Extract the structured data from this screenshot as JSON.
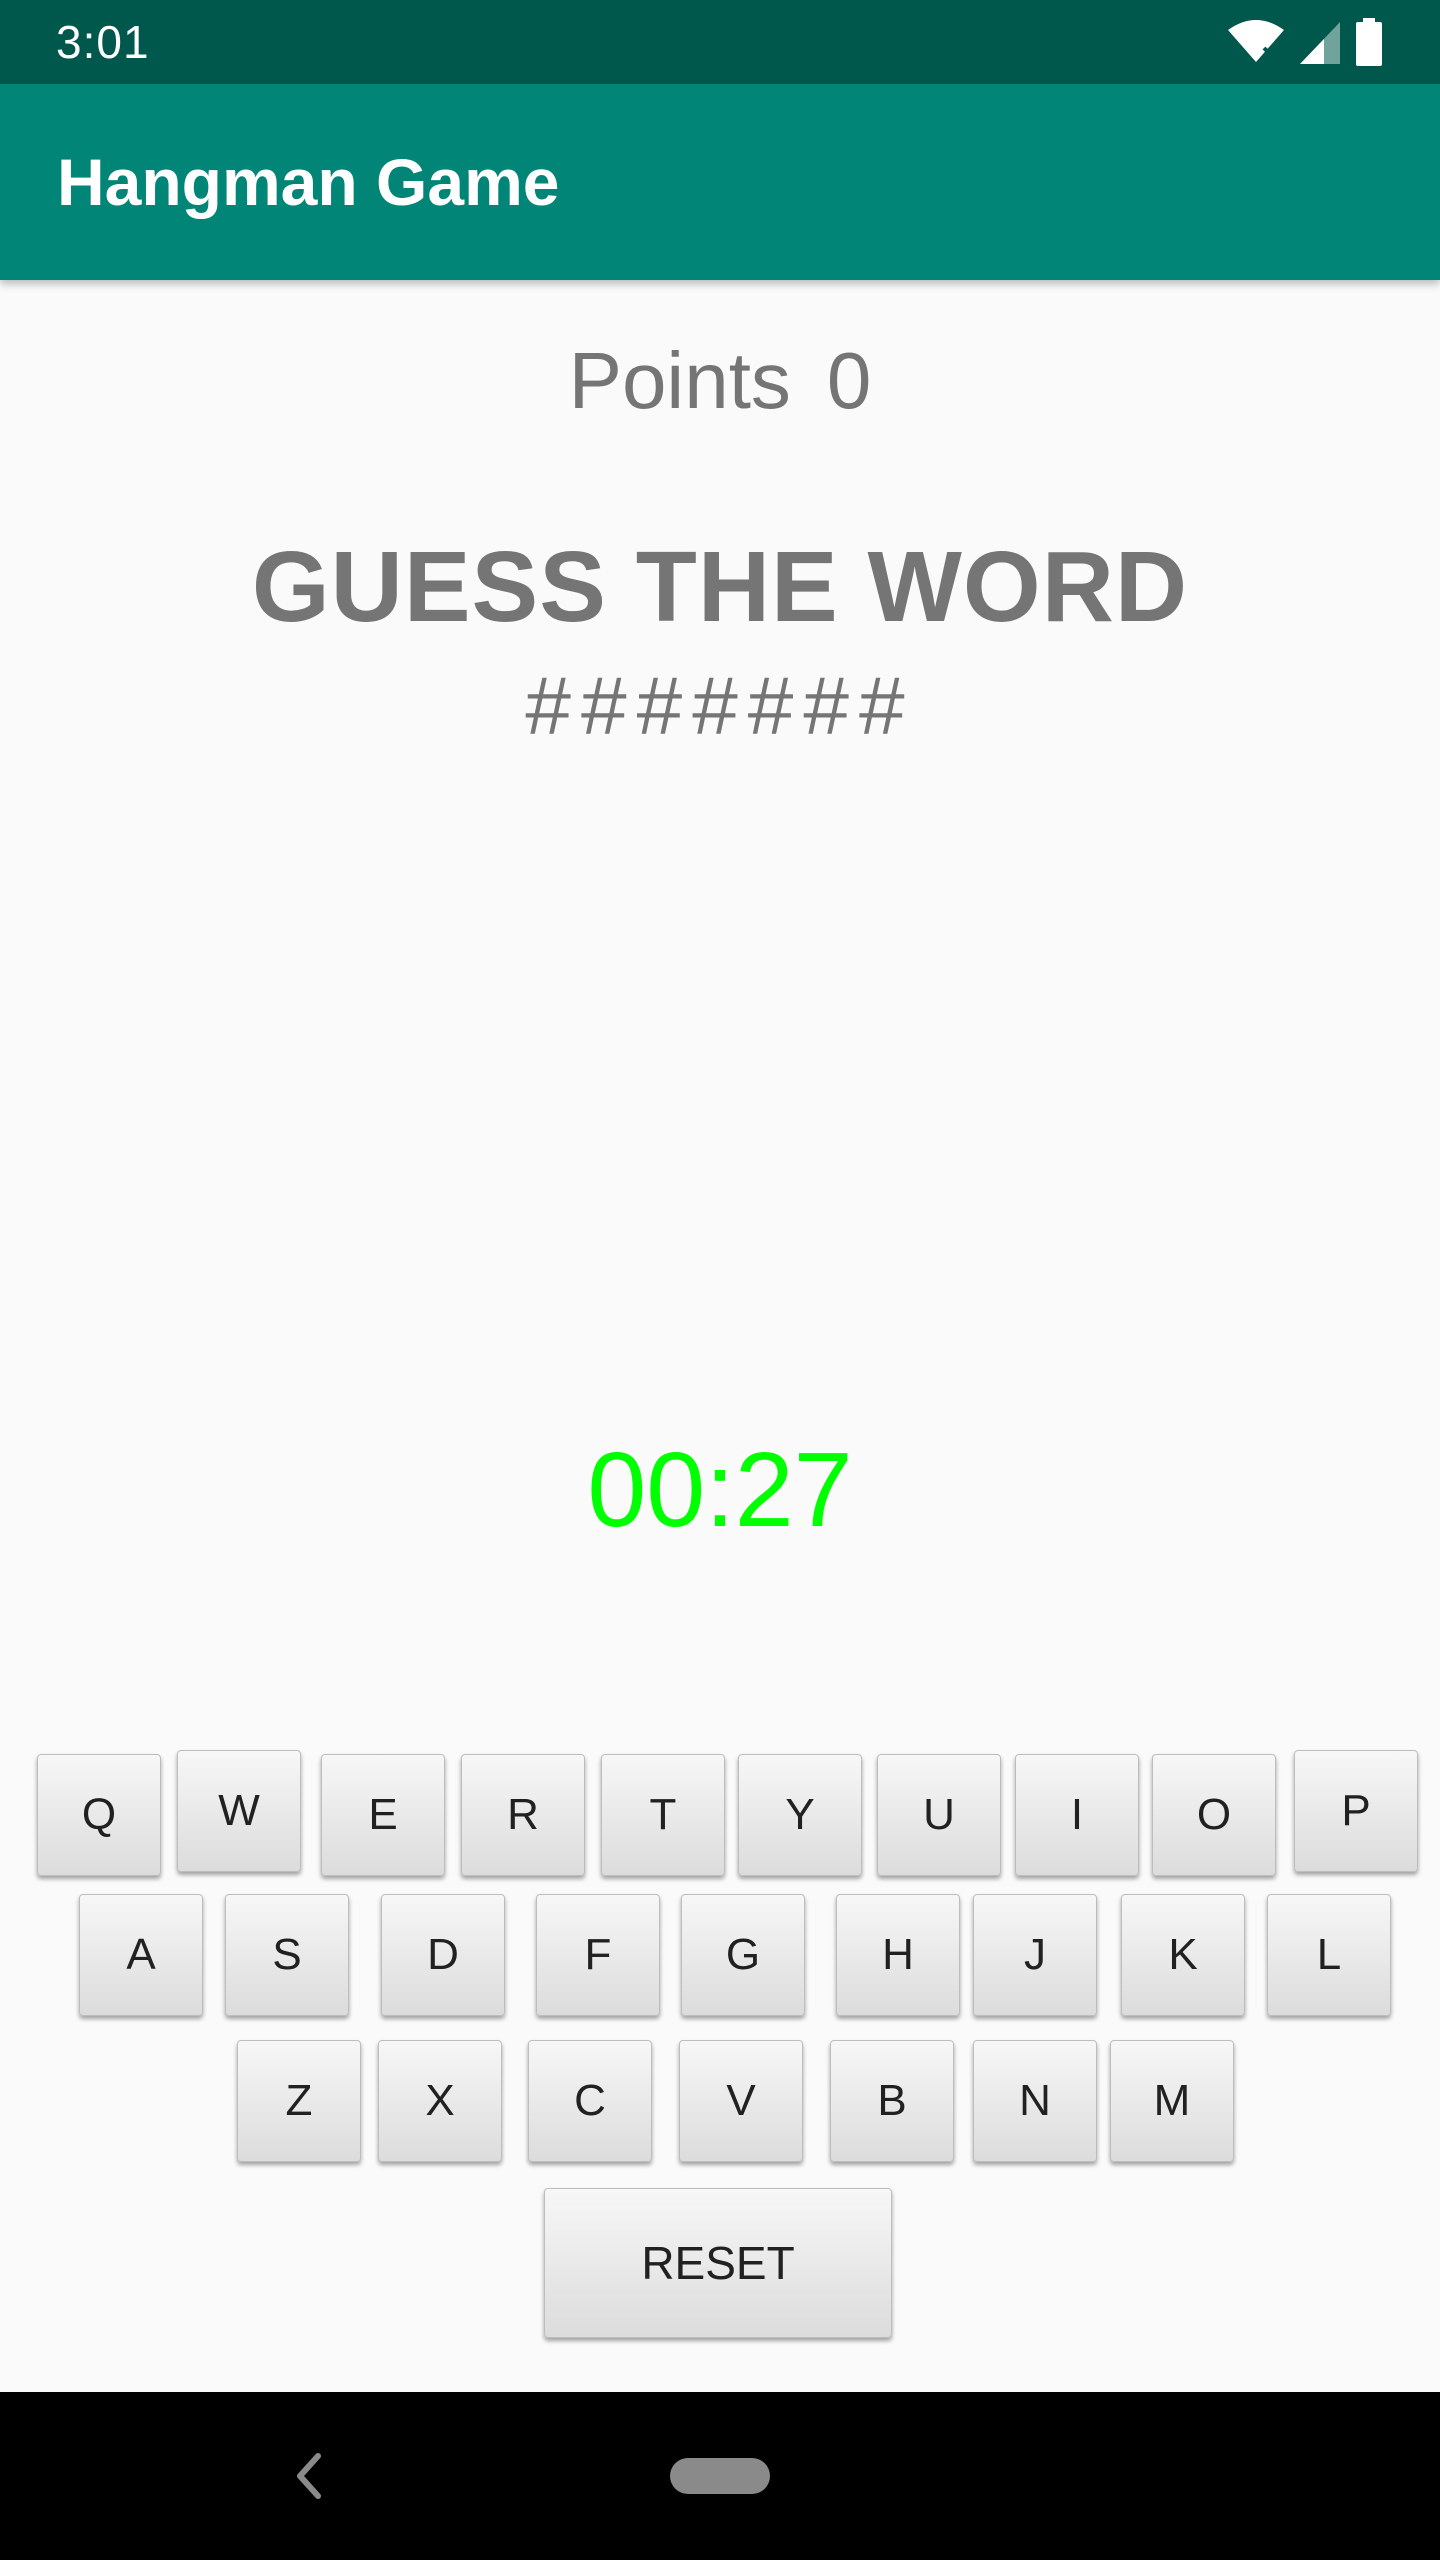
{
  "status_bar": {
    "time": "3:01",
    "icons": [
      "wifi-icon",
      "signal-icon",
      "battery-icon"
    ]
  },
  "app_bar": {
    "title": "Hangman Game"
  },
  "game": {
    "points_label": "Points",
    "points_value": "0",
    "title": "GUESS THE WORD",
    "masked_word": "#######",
    "timer": "00:27"
  },
  "keyboard": {
    "row1": [
      "Q",
      "W",
      "E",
      "R",
      "T",
      "Y",
      "U",
      "I",
      "O",
      "P"
    ],
    "row2": [
      "A",
      "S",
      "D",
      "F",
      "G",
      "H",
      "J",
      "K",
      "L"
    ],
    "row3": [
      "Z",
      "X",
      "C",
      "V",
      "B",
      "N",
      "M"
    ],
    "reset_label": "RESET"
  },
  "nav_bar": {
    "icons": [
      "back-icon",
      "home-icon"
    ]
  },
  "colors": {
    "status_bar": "#00574b",
    "app_bar": "#008577",
    "text_gray": "#757575",
    "timer_green": "#00ff00"
  }
}
